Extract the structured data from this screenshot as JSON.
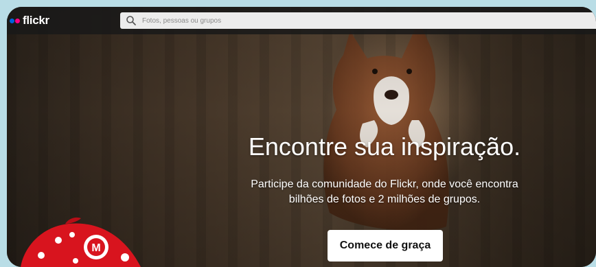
{
  "header": {
    "logo_text": "flickr",
    "search": {
      "placeholder": "Fotos, pessoas ou grupos",
      "icon": "search-icon"
    }
  },
  "hero": {
    "headline": "Encontre sua inspiração.",
    "subtext_line1": "Participe da comunidade do Flickr, onde você encontra",
    "subtext_line2": "bilhões de fotos e 2 milhões de grupos.",
    "cta_label": "Comece de graça"
  },
  "mascot": {
    "letter": "M"
  },
  "colors": {
    "logo_blue": "#0063dc",
    "logo_pink": "#ff0084",
    "cta_bg": "#ffffff"
  }
}
